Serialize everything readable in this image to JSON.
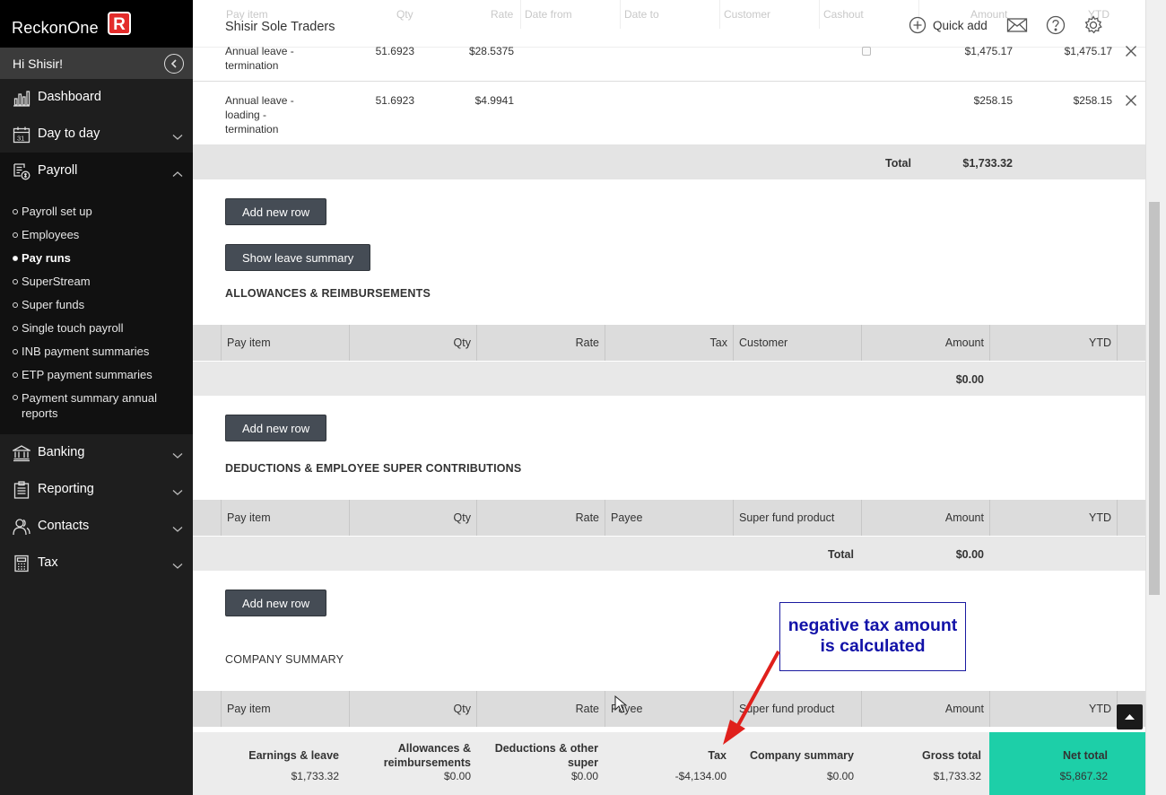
{
  "brand": {
    "name": "ReckonOne",
    "badge": "R"
  },
  "sidebar": {
    "greeting": "Hi Shisir!",
    "nav": [
      {
        "label": "Dashboard",
        "icon": "bar-chart-icon"
      },
      {
        "label": "Day to day",
        "icon": "calendar-icon",
        "day": "31"
      },
      {
        "label": "Payroll",
        "icon": "payroll-icon"
      },
      {
        "label": "Banking",
        "icon": "bank-icon"
      },
      {
        "label": "Reporting",
        "icon": "report-icon"
      },
      {
        "label": "Contacts",
        "icon": "contacts-icon"
      },
      {
        "label": "Tax",
        "icon": "calculator-icon"
      }
    ],
    "payroll_sub": [
      "Payroll set up",
      "Employees",
      "Pay runs",
      "SuperStream",
      "Super funds",
      "Single touch payroll",
      "INB payment summaries",
      "ETP payment summaries",
      "Payment summary annual reports"
    ],
    "active_sub": "Pay runs"
  },
  "topbar": {
    "company": "Shisir Sole Traders",
    "quick_add": "Quick add",
    "ghost_headers": [
      "Pay item",
      "Qty",
      "Rate",
      "Date from",
      "Date to",
      "Customer",
      "Cashout",
      "Amount",
      "YTD"
    ]
  },
  "leave_rows": [
    {
      "item": [
        "Annual leave -",
        "termination"
      ],
      "qty": "51.6923",
      "rate": "$28.5375",
      "amount": "$1,475.17",
      "ytd": "$1,475.17"
    },
    {
      "item": [
        "Annual leave -",
        "loading -",
        "termination"
      ],
      "qty": "51.6923",
      "rate": "$4.9941",
      "amount": "$258.15",
      "ytd": "$258.15"
    }
  ],
  "leave_total": {
    "label": "Total",
    "value": "$1,733.32"
  },
  "buttons": {
    "add_row": "Add new row",
    "leave_summary": "Show leave summary"
  },
  "allowances": {
    "title": "ALLOWANCES & REIMBURSEMENTS",
    "headers": [
      "Pay item",
      "Qty",
      "Rate",
      "Tax",
      "Customer",
      "Amount",
      "YTD"
    ],
    "total": "$0.00"
  },
  "deductions": {
    "title": "DEDUCTIONS & EMPLOYEE SUPER CONTRIBUTIONS",
    "headers": [
      "Pay item",
      "Qty",
      "Rate",
      "Payee",
      "Super fund product",
      "Amount",
      "YTD"
    ],
    "total_label": "Total",
    "total": "$0.00"
  },
  "company_summary": {
    "title": "COMPANY SUMMARY",
    "headers": [
      "Pay item",
      "Qty",
      "Rate",
      "Payee",
      "Super fund product",
      "Amount",
      "YTD"
    ]
  },
  "summary": {
    "earnings": {
      "label": "Earnings & leave",
      "value": "$1,733.32"
    },
    "allowances": {
      "label": "Allowances & reimbursements",
      "value": "$0.00"
    },
    "deductions": {
      "label": "Deductions & other super",
      "value": "$0.00"
    },
    "tax": {
      "label": "Tax",
      "value": "-$4,134.00"
    },
    "company": {
      "label": "Company summary",
      "value": "$0.00"
    },
    "gross": {
      "label": "Gross total",
      "value": "$1,733.32"
    },
    "net": {
      "label": "Net total",
      "value": "$5,867.32"
    }
  },
  "annotation": {
    "text": "negative tax amount is calculated",
    "color": "#1212a8",
    "arrow_color": "#e0201c"
  },
  "colors": {
    "sidebar": "#1e1e1e",
    "net_total": "#1dcfa8",
    "button": "#454c55",
    "brand_red": "#e32c2b"
  }
}
